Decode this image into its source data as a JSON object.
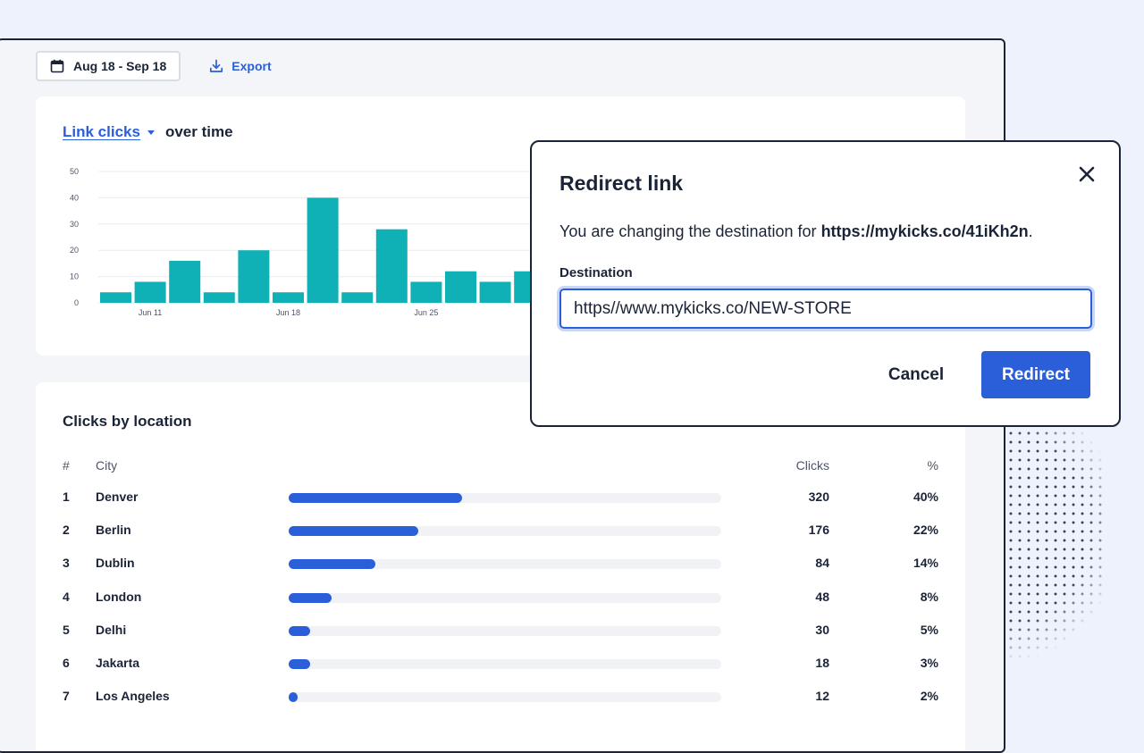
{
  "toolbar": {
    "date_range": "Aug 18 - Sep 18",
    "export_label": "Export"
  },
  "chart_card": {
    "metric_label": "Link clicks",
    "suffix": "over time"
  },
  "chart_data": {
    "type": "bar",
    "title": "Link clicks over time",
    "ylim": [
      0,
      50
    ],
    "yticks": [
      0,
      10,
      20,
      30,
      40,
      50
    ],
    "grid": true,
    "xtick_labels": [
      {
        "index": 1,
        "label": "Jun 11"
      },
      {
        "index": 5,
        "label": "Jun 18"
      },
      {
        "index": 9,
        "label": "Jun 25"
      }
    ],
    "values": [
      4,
      8,
      16,
      4,
      20,
      4,
      40,
      4,
      28,
      8,
      12,
      8,
      12
    ],
    "color": "#0fb0b6"
  },
  "locations": {
    "title": "Clicks by location",
    "headers": {
      "rank": "#",
      "city": "City",
      "clicks": "Clicks",
      "pct": "%"
    },
    "rows": [
      {
        "rank": "1",
        "city": "Denver",
        "clicks": "320",
        "pct": "40%",
        "share": 0.4
      },
      {
        "rank": "2",
        "city": "Berlin",
        "clicks": "176",
        "pct": "22%",
        "share": 0.3
      },
      {
        "rank": "3",
        "city": "Dublin",
        "clicks": "84",
        "pct": "14%",
        "share": 0.2
      },
      {
        "rank": "4",
        "city": "London",
        "clicks": "48",
        "pct": "8%",
        "share": 0.1
      },
      {
        "rank": "5",
        "city": "Delhi",
        "clicks": "30",
        "pct": "5%",
        "share": 0.05
      },
      {
        "rank": "6",
        "city": "Jakarta",
        "clicks": "18",
        "pct": "3%",
        "share": 0.05
      },
      {
        "rank": "7",
        "city": "Los Angeles",
        "clicks": "12",
        "pct": "2%",
        "share": 0.02
      }
    ]
  },
  "modal": {
    "title": "Redirect link",
    "description_prefix": "You are changing the destination for ",
    "short_link": "https://mykicks.co/41iKh2n",
    "description_suffix": ".",
    "destination_label": "Destination",
    "destination_value": "https//www.mykicks.co/NEW-STORE",
    "cancel_label": "Cancel",
    "redirect_label": "Redirect"
  },
  "colors": {
    "accent": "#2b5fd9",
    "bar": "#0fb0b6",
    "text": "#1b2437"
  }
}
